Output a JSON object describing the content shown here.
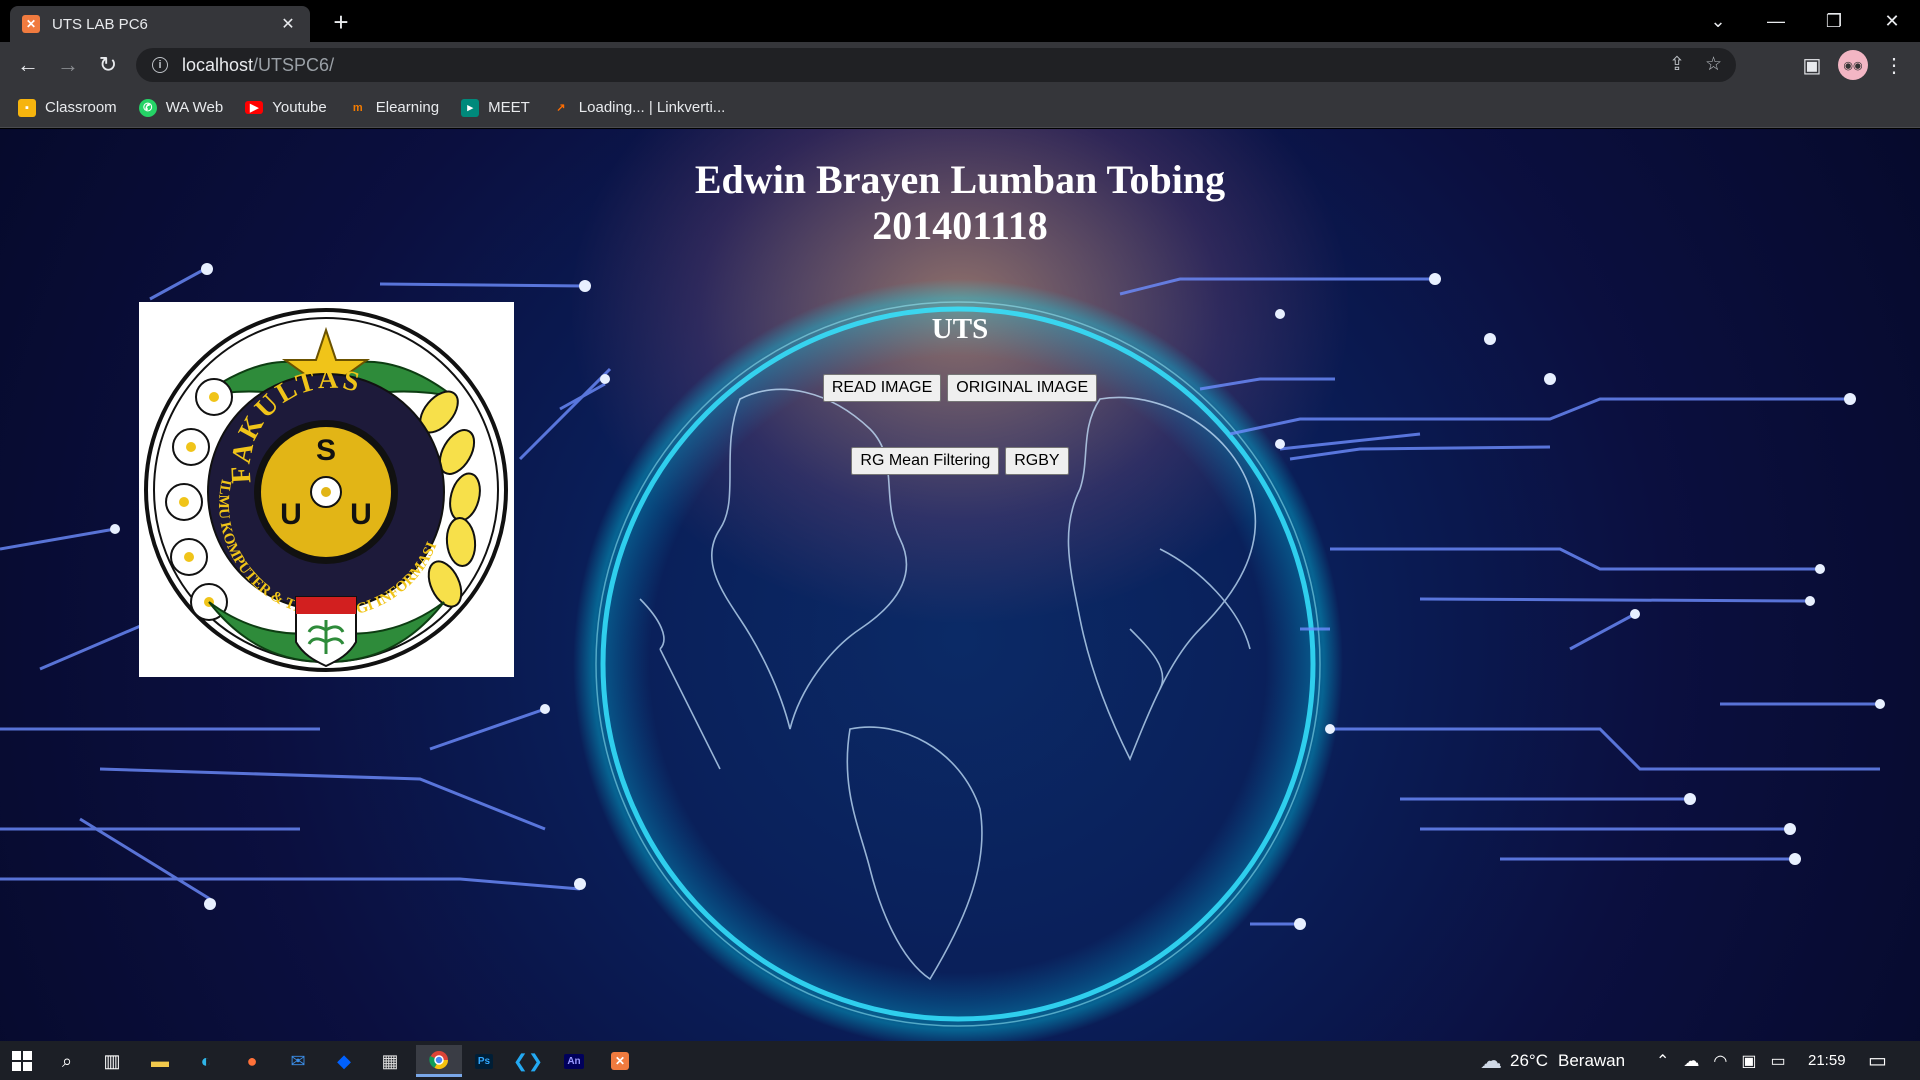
{
  "browser": {
    "tab_title": "UTS LAB PC6",
    "url_host": "localhost",
    "url_path": "/UTSPC6/",
    "bookmarks": [
      {
        "label": "Classroom",
        "icon": "classroom-icon",
        "color": "#f6b40e"
      },
      {
        "label": "WA Web",
        "icon": "whatsapp-icon",
        "color": "#25d366"
      },
      {
        "label": "Youtube",
        "icon": "youtube-icon",
        "color": "#ff0000"
      },
      {
        "label": "Elearning",
        "icon": "elearning-icon",
        "color": "#f57c00"
      },
      {
        "label": "MEET",
        "icon": "meet-icon",
        "color": "#00897b"
      },
      {
        "label": "Loading... | Linkverti...",
        "icon": "linkvertise-icon",
        "color": "#ff6d00"
      }
    ]
  },
  "page": {
    "name": "Edwin Brayen Lumban Tobing",
    "nim": "201401118",
    "section_title": "UTS",
    "buttons_row1": [
      "READ IMAGE",
      "ORIGINAL IMAGE"
    ],
    "buttons_row2": [
      "RG Mean Filtering",
      "RGBY"
    ],
    "logo": {
      "top_text": "FAKULTAS",
      "ring_text": "ILMU KOMPUTER & TEKNOLOGI INFORMASI",
      "center_letters": [
        "S",
        "U",
        "U"
      ]
    }
  },
  "taskbar": {
    "weather_temp": "26°C",
    "weather_desc": "Berawan",
    "time": "21:59"
  }
}
